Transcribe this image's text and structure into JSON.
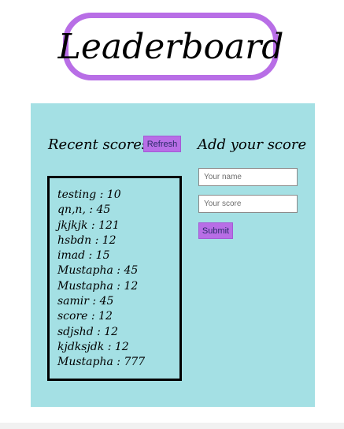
{
  "header": {
    "title": "Leaderboard"
  },
  "recent": {
    "title": "Recent scores",
    "refresh_label": "Refresh",
    "scores": [
      "testing : 10",
      "qn,n, : 45",
      "jkjkjk : 121",
      "hsbdn : 12",
      "imad : 15",
      "Mustapha : 45",
      "Mustapha : 12",
      "samir : 45",
      "score : 12",
      "sdjshd : 12",
      "kjdksjdk : 12",
      "Mustapha : 777"
    ]
  },
  "add": {
    "title": "Add your score",
    "name_placeholder": "Your name",
    "score_placeholder": "Your score",
    "submit_label": "Submit"
  },
  "colors": {
    "accent": "#b86ee6",
    "panel": "#a4e0e4"
  }
}
